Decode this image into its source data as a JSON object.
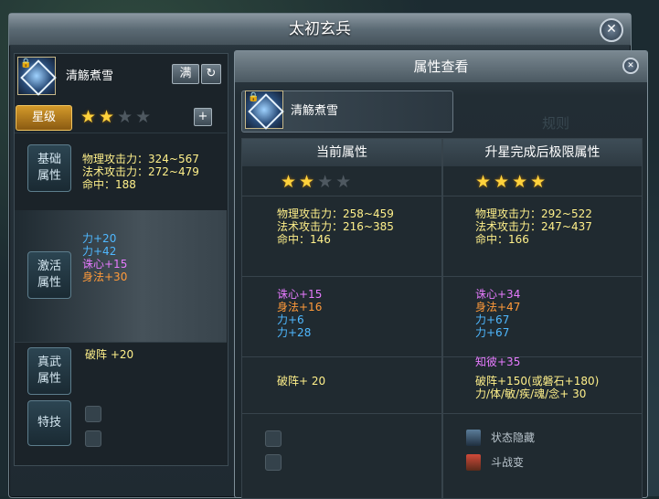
{
  "window": {
    "title": "太初玄兵"
  },
  "left": {
    "item_name": "清觞煮雪",
    "max_button": "满",
    "refresh_button": "↻",
    "star_label": "星级",
    "stars_filled": 2,
    "stars_total": 4,
    "add_button": "+",
    "base": {
      "label1": "基础",
      "label2": "属性",
      "lines": [
        "物理攻击力：324~567",
        "法术攻击力：272~479",
        "命中：188"
      ]
    },
    "active": {
      "label1": "激活",
      "label2": "属性",
      "lines": [
        {
          "text": "力+20",
          "color": "#4fb8ff"
        },
        {
          "text": "力+42",
          "color": "#4fb8ff"
        },
        {
          "text": "诛心+15",
          "color": "#e77bff"
        },
        {
          "text": "身法+30",
          "color": "#ff9a3a"
        }
      ]
    },
    "zhenwu": {
      "label1": "真武",
      "label2": "属性",
      "text": "破阵 +20"
    },
    "skill": {
      "label": "特技"
    }
  },
  "popup": {
    "title": "属性查看",
    "item_name": "清觞煮雪",
    "ghost_text": "规则",
    "current": {
      "header": "当前属性",
      "stars_filled": 2,
      "stars_total": 4,
      "base": [
        "物理攻击力：258~459",
        "法术攻击力：216~385",
        "命中：146"
      ],
      "active": [
        {
          "text": "诛心+15",
          "color": "#e77bff"
        },
        {
          "text": "身法+16",
          "color": "#ff9a3a"
        },
        {
          "text": "力+6",
          "color": "#4fb8ff"
        },
        {
          "text": "力+28",
          "color": "#4fb8ff"
        }
      ],
      "zhenwu": [
        "破阵+ 20"
      ]
    },
    "max": {
      "header": "升星完成后极限属性",
      "stars_filled": 4,
      "stars_total": 4,
      "base": [
        "物理攻击力：292~522",
        "法术攻击力：247~437",
        "命中：166"
      ],
      "active": [
        {
          "text": "诛心+34",
          "color": "#e77bff"
        },
        {
          "text": "身法+47",
          "color": "#ff9a3a"
        },
        {
          "text": "力+67",
          "color": "#4fb8ff"
        },
        {
          "text": "力+67",
          "color": "#4fb8ff"
        }
      ],
      "extra": {
        "text": "知彼+35",
        "color": "#e77bff"
      },
      "zhenwu": [
        "破阵+150(或磐石+180)",
        "力/体/敏/疾/魂/念+ 30"
      ],
      "skills": [
        "状态隐藏",
        "斗战变"
      ]
    }
  }
}
